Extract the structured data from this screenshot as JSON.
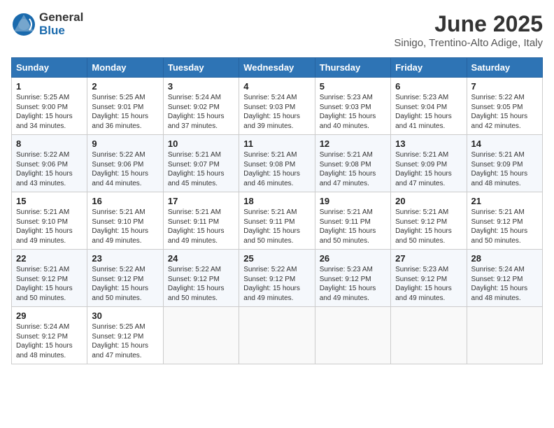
{
  "header": {
    "logo_general": "General",
    "logo_blue": "Blue",
    "title": "June 2025",
    "subtitle": "Sinigo, Trentino-Alto Adige, Italy"
  },
  "weekdays": [
    "Sunday",
    "Monday",
    "Tuesday",
    "Wednesday",
    "Thursday",
    "Friday",
    "Saturday"
  ],
  "weeks": [
    [
      {
        "day": "1",
        "info": "Sunrise: 5:25 AM\nSunset: 9:00 PM\nDaylight: 15 hours\nand 34 minutes."
      },
      {
        "day": "2",
        "info": "Sunrise: 5:25 AM\nSunset: 9:01 PM\nDaylight: 15 hours\nand 36 minutes."
      },
      {
        "day": "3",
        "info": "Sunrise: 5:24 AM\nSunset: 9:02 PM\nDaylight: 15 hours\nand 37 minutes."
      },
      {
        "day": "4",
        "info": "Sunrise: 5:24 AM\nSunset: 9:03 PM\nDaylight: 15 hours\nand 39 minutes."
      },
      {
        "day": "5",
        "info": "Sunrise: 5:23 AM\nSunset: 9:03 PM\nDaylight: 15 hours\nand 40 minutes."
      },
      {
        "day": "6",
        "info": "Sunrise: 5:23 AM\nSunset: 9:04 PM\nDaylight: 15 hours\nand 41 minutes."
      },
      {
        "day": "7",
        "info": "Sunrise: 5:22 AM\nSunset: 9:05 PM\nDaylight: 15 hours\nand 42 minutes."
      }
    ],
    [
      {
        "day": "8",
        "info": "Sunrise: 5:22 AM\nSunset: 9:06 PM\nDaylight: 15 hours\nand 43 minutes."
      },
      {
        "day": "9",
        "info": "Sunrise: 5:22 AM\nSunset: 9:06 PM\nDaylight: 15 hours\nand 44 minutes."
      },
      {
        "day": "10",
        "info": "Sunrise: 5:21 AM\nSunset: 9:07 PM\nDaylight: 15 hours\nand 45 minutes."
      },
      {
        "day": "11",
        "info": "Sunrise: 5:21 AM\nSunset: 9:08 PM\nDaylight: 15 hours\nand 46 minutes."
      },
      {
        "day": "12",
        "info": "Sunrise: 5:21 AM\nSunset: 9:08 PM\nDaylight: 15 hours\nand 47 minutes."
      },
      {
        "day": "13",
        "info": "Sunrise: 5:21 AM\nSunset: 9:09 PM\nDaylight: 15 hours\nand 47 minutes."
      },
      {
        "day": "14",
        "info": "Sunrise: 5:21 AM\nSunset: 9:09 PM\nDaylight: 15 hours\nand 48 minutes."
      }
    ],
    [
      {
        "day": "15",
        "info": "Sunrise: 5:21 AM\nSunset: 9:10 PM\nDaylight: 15 hours\nand 49 minutes."
      },
      {
        "day": "16",
        "info": "Sunrise: 5:21 AM\nSunset: 9:10 PM\nDaylight: 15 hours\nand 49 minutes."
      },
      {
        "day": "17",
        "info": "Sunrise: 5:21 AM\nSunset: 9:11 PM\nDaylight: 15 hours\nand 49 minutes."
      },
      {
        "day": "18",
        "info": "Sunrise: 5:21 AM\nSunset: 9:11 PM\nDaylight: 15 hours\nand 50 minutes."
      },
      {
        "day": "19",
        "info": "Sunrise: 5:21 AM\nSunset: 9:11 PM\nDaylight: 15 hours\nand 50 minutes."
      },
      {
        "day": "20",
        "info": "Sunrise: 5:21 AM\nSunset: 9:12 PM\nDaylight: 15 hours\nand 50 minutes."
      },
      {
        "day": "21",
        "info": "Sunrise: 5:21 AM\nSunset: 9:12 PM\nDaylight: 15 hours\nand 50 minutes."
      }
    ],
    [
      {
        "day": "22",
        "info": "Sunrise: 5:21 AM\nSunset: 9:12 PM\nDaylight: 15 hours\nand 50 minutes."
      },
      {
        "day": "23",
        "info": "Sunrise: 5:22 AM\nSunset: 9:12 PM\nDaylight: 15 hours\nand 50 minutes."
      },
      {
        "day": "24",
        "info": "Sunrise: 5:22 AM\nSunset: 9:12 PM\nDaylight: 15 hours\nand 50 minutes."
      },
      {
        "day": "25",
        "info": "Sunrise: 5:22 AM\nSunset: 9:12 PM\nDaylight: 15 hours\nand 49 minutes."
      },
      {
        "day": "26",
        "info": "Sunrise: 5:23 AM\nSunset: 9:12 PM\nDaylight: 15 hours\nand 49 minutes."
      },
      {
        "day": "27",
        "info": "Sunrise: 5:23 AM\nSunset: 9:12 PM\nDaylight: 15 hours\nand 49 minutes."
      },
      {
        "day": "28",
        "info": "Sunrise: 5:24 AM\nSunset: 9:12 PM\nDaylight: 15 hours\nand 48 minutes."
      }
    ],
    [
      {
        "day": "29",
        "info": "Sunrise: 5:24 AM\nSunset: 9:12 PM\nDaylight: 15 hours\nand 48 minutes."
      },
      {
        "day": "30",
        "info": "Sunrise: 5:25 AM\nSunset: 9:12 PM\nDaylight: 15 hours\nand 47 minutes."
      },
      {
        "day": "",
        "info": ""
      },
      {
        "day": "",
        "info": ""
      },
      {
        "day": "",
        "info": ""
      },
      {
        "day": "",
        "info": ""
      },
      {
        "day": "",
        "info": ""
      }
    ]
  ]
}
